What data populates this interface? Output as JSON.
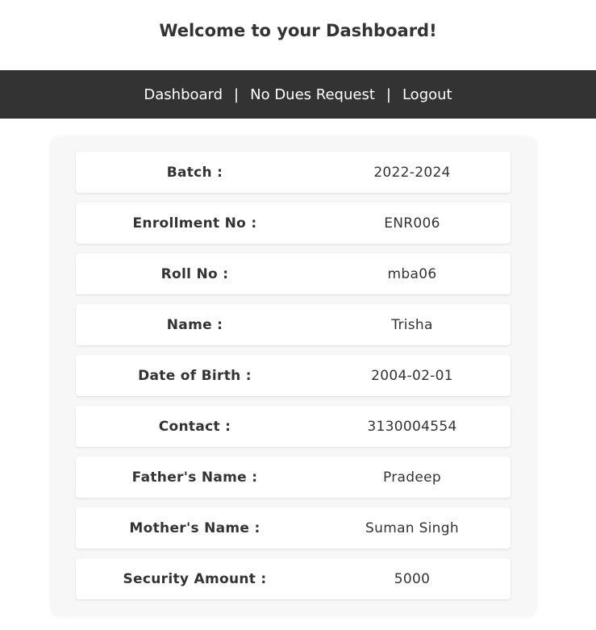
{
  "header": {
    "title": "Welcome to your Dashboard!"
  },
  "nav": {
    "items": [
      {
        "label": "Dashboard"
      },
      {
        "label": "No Dues Request"
      },
      {
        "label": "Logout"
      }
    ],
    "separator": "|"
  },
  "details": [
    {
      "label": "Batch :",
      "value": "2022-2024"
    },
    {
      "label": "Enrollment No :",
      "value": "ENR006"
    },
    {
      "label": "Roll No :",
      "value": "mba06"
    },
    {
      "label": "Name :",
      "value": "Trisha"
    },
    {
      "label": "Date of Birth :",
      "value": "2004-02-01"
    },
    {
      "label": "Contact :",
      "value": "3130004554"
    },
    {
      "label": "Father's Name :",
      "value": "Pradeep"
    },
    {
      "label": "Mother's Name :",
      "value": "Suman Singh"
    },
    {
      "label": "Security Amount :",
      "value": "5000"
    }
  ],
  "colors": {
    "navbar_bg": "#333333",
    "card_bg": "#f7f7f7",
    "row_bg": "#ffffff"
  }
}
